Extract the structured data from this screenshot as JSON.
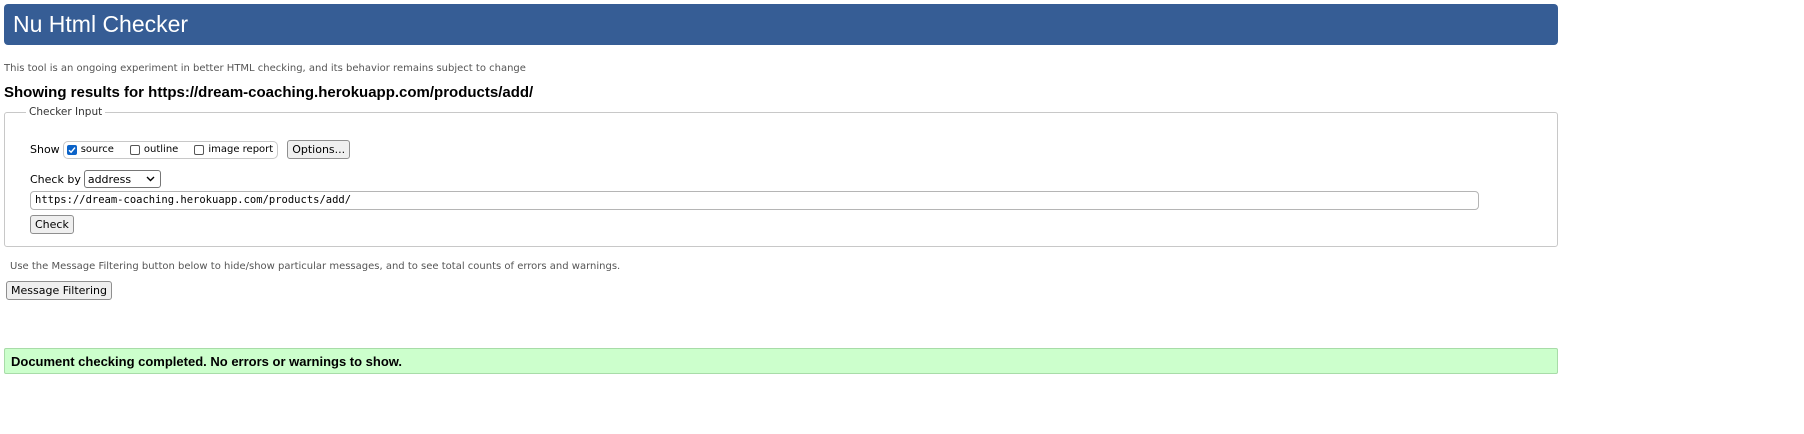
{
  "header": {
    "title": "Nu Html Checker",
    "subtitle": "This tool is an ongoing experiment in better HTML checking, and its behavior remains subject to change",
    "results_heading": "Showing results for https://dream-coaching.herokuapp.com/products/add/"
  },
  "checker_input": {
    "legend": "Checker Input",
    "show_label": "Show",
    "options": [
      {
        "label": "source",
        "checked": true
      },
      {
        "label": "outline",
        "checked": false
      },
      {
        "label": "image report",
        "checked": false
      }
    ],
    "options_button": "Options...",
    "check_by_label": "Check by",
    "check_by_value": "address",
    "url_value": "https://dream-coaching.herokuapp.com/products/add/",
    "check_button": "Check"
  },
  "filtering": {
    "note": "Use the Message Filtering button below to hide/show particular messages, and to see total counts of errors and warnings.",
    "button": "Message Filtering"
  },
  "result": {
    "message": "Document checking completed. No errors or warnings to show."
  },
  "colors": {
    "title_bar": "#365d95",
    "success_bg": "#ccffcc",
    "checkbox_checked": "#0b63c8"
  }
}
